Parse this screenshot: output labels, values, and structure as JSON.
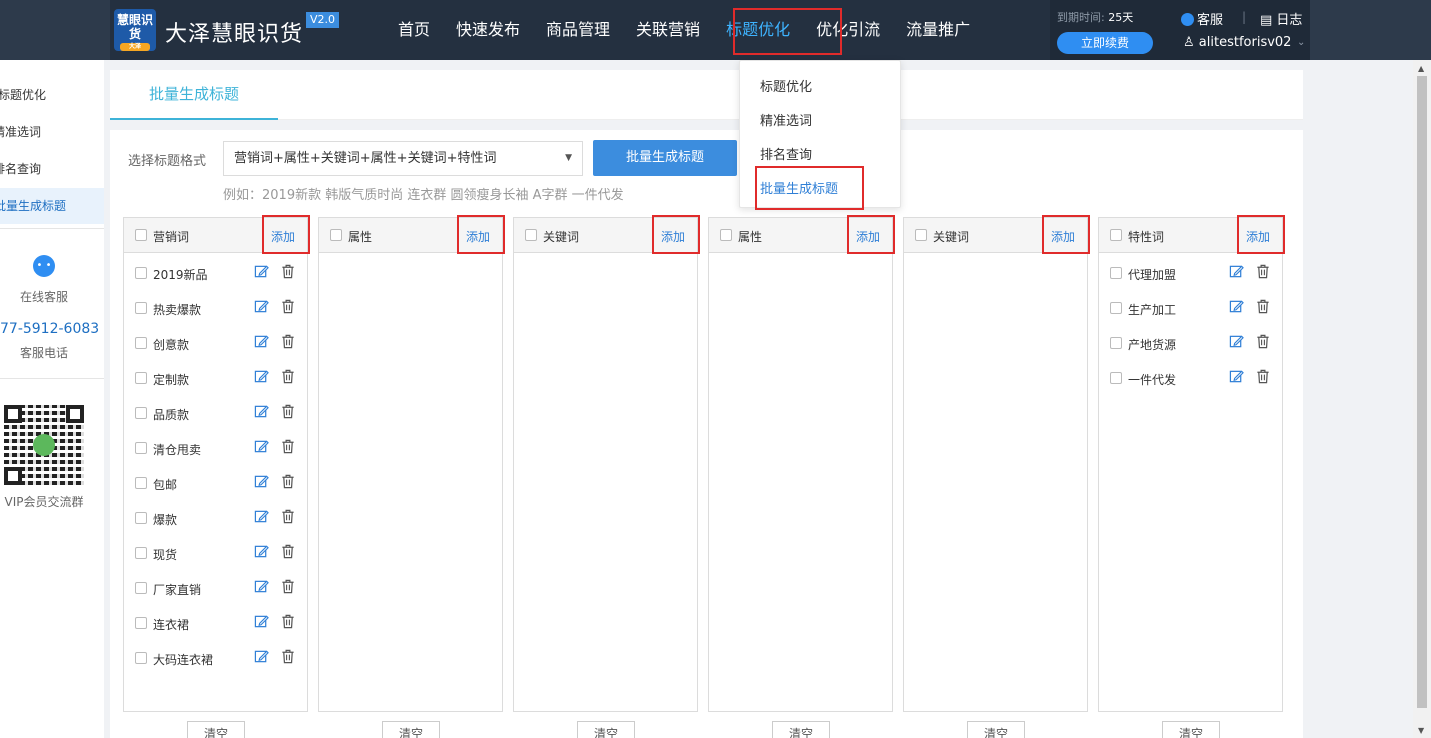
{
  "header": {
    "logo_text": "慧眼识货",
    "logo_sub": "大泽",
    "brand": "大泽慧眼识货",
    "version": "V2.0",
    "nav": [
      "首页",
      "快速发布",
      "商品管理",
      "关联营销",
      "标题优化",
      "优化引流",
      "流量推广"
    ],
    "active_nav": "标题优化",
    "expire_label": "到期时间:",
    "expire_value": "25天",
    "renew": "立即续费",
    "service": "客服",
    "separator": "|",
    "log": "日志",
    "username": "alitestforisv02"
  },
  "sidebar": {
    "items": [
      "标题优化",
      "精准选词",
      "排名查询",
      "批量生成标题"
    ],
    "active": "批量生成标题",
    "service_label": "在线客服",
    "phone": "77-5912-6083",
    "phone_label": "客服电话",
    "qr_label": "VIP会员交流群"
  },
  "main": {
    "tab": "批量生成标题",
    "format_label": "选择标题格式",
    "format_value": "营销词+属性+关键词+属性+关键词+特性词",
    "generate_button": "批量生成标题",
    "example": "例如：2019新款 韩版气质时尚 连衣群 圆领瘦身长袖 A字群 一件代发",
    "add_label": "添加",
    "clear_label": "清空",
    "columns": [
      {
        "title": "营销词",
        "items": [
          "2019新品",
          "热卖爆款",
          "创意款",
          "定制款",
          "品质款",
          "清仓甩卖",
          "包邮",
          "爆款",
          "现货",
          "厂家直销",
          "连衣裙",
          "大码连衣裙"
        ]
      },
      {
        "title": "属性",
        "items": []
      },
      {
        "title": "关键词",
        "items": []
      },
      {
        "title": "属性",
        "items": []
      },
      {
        "title": "关键词",
        "items": []
      },
      {
        "title": "特性词",
        "items": [
          "代理加盟",
          "生产加工",
          "产地货源",
          "一件代发"
        ]
      }
    ]
  },
  "dropdown": {
    "items": [
      "标题优化",
      "精准选词",
      "排名查询",
      "批量生成标题"
    ],
    "active": "批量生成标题"
  },
  "colors": {
    "topbar": "#2d3a4b",
    "accent": "#3eb3ff",
    "button": "#3c8dde",
    "link": "#2f7fd6",
    "highlight": "#e02b2b"
  }
}
